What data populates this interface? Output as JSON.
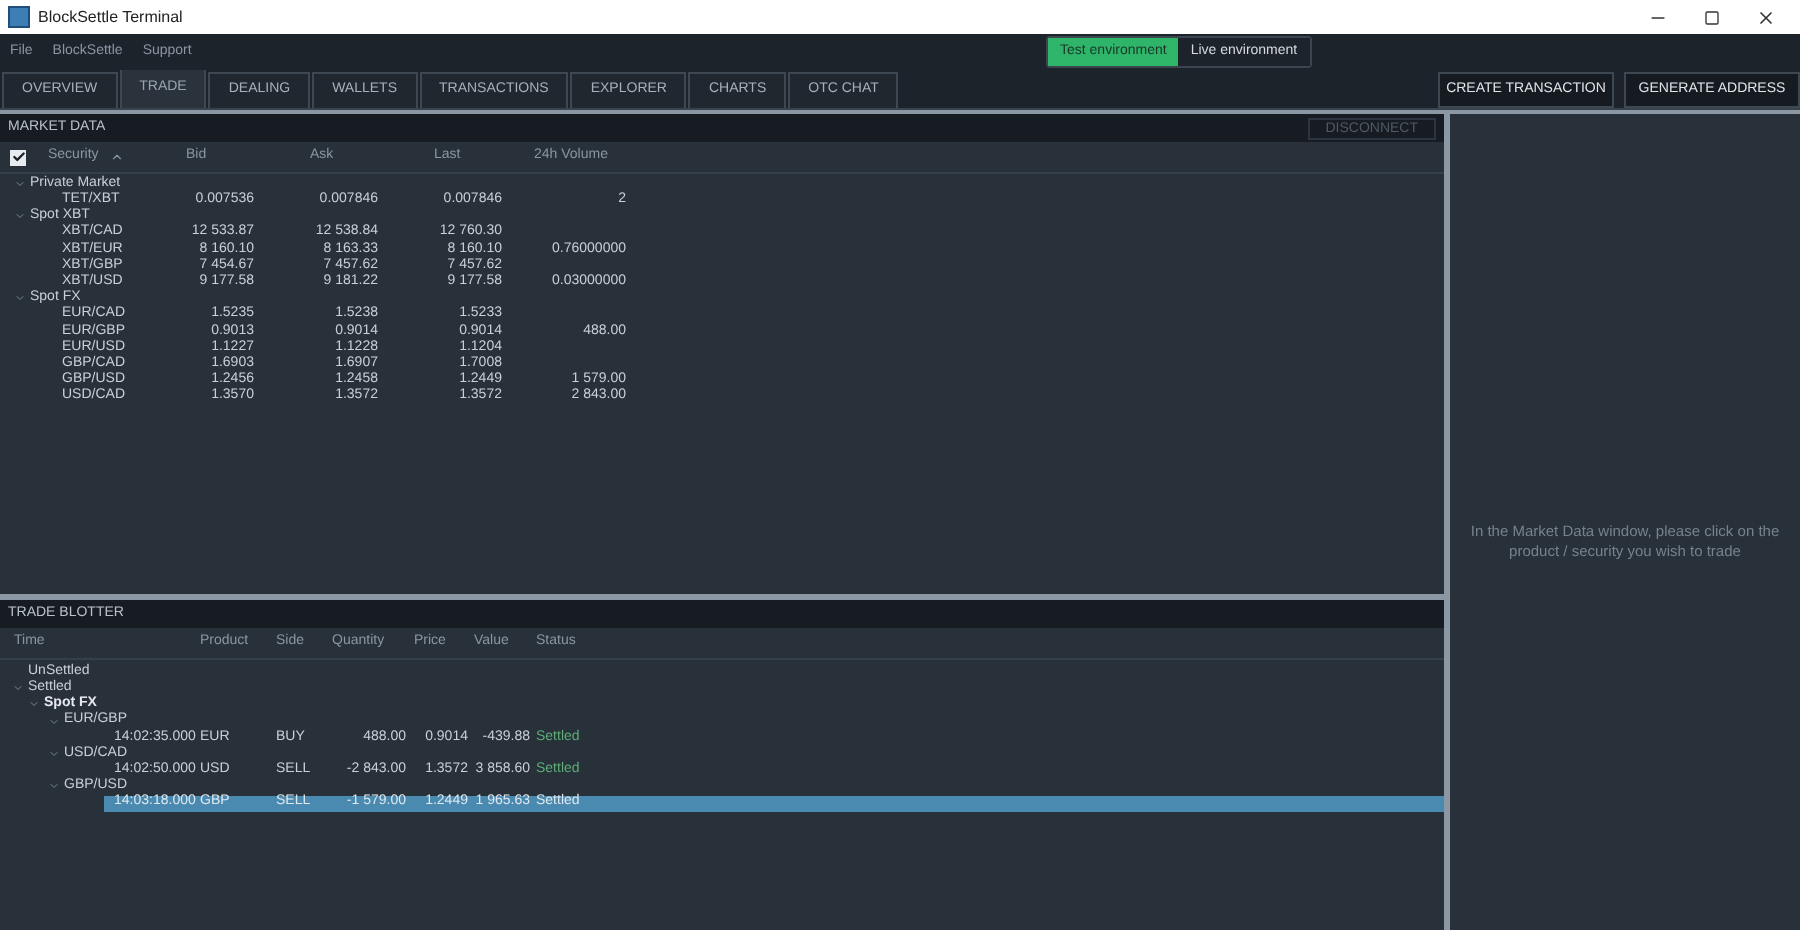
{
  "window": {
    "title": "BlockSettle Terminal"
  },
  "menu": [
    "File",
    "BlockSettle",
    "Support"
  ],
  "environment": [
    {
      "label": "Test environment",
      "selected": true
    },
    {
      "label": "Live environment",
      "selected": false
    }
  ],
  "tabs": [
    {
      "label": "OVERVIEW",
      "selected": false
    },
    {
      "label": "TRADE",
      "selected": true
    },
    {
      "label": "DEALING",
      "selected": false
    },
    {
      "label": "WALLETS",
      "selected": false
    },
    {
      "label": "TRANSACTIONS",
      "selected": false
    },
    {
      "label": "EXPLORER",
      "selected": false
    },
    {
      "label": "CHARTS",
      "selected": false
    },
    {
      "label": "OTC CHAT",
      "selected": false
    }
  ],
  "actions": [
    "CREATE TRANSACTION",
    "GENERATE ADDRESS"
  ],
  "market_data": {
    "title": "MARKET DATA",
    "disconnect": {
      "label": "DISCONNECT",
      "disabled": true
    },
    "checked": true,
    "columns": [
      "Security",
      "Bid",
      "Ask",
      "Last",
      "24h Volume"
    ],
    "groups": [
      {
        "name": "Private Market",
        "expanded": true,
        "rows": [
          {
            "security": "TET/XBT",
            "bid": "0.007536",
            "ask": "0.007846",
            "last": "0.007846",
            "volume": "2"
          }
        ]
      },
      {
        "name": "Spot XBT",
        "expanded": true,
        "rows": [
          {
            "security": "XBT/CAD",
            "bid": "12 533.87",
            "ask": "12 538.84",
            "last": "12 760.30"
          },
          {
            "security": "XBT/EUR",
            "bid": "8 160.10",
            "ask": "8 163.33",
            "last": "8 160.10",
            "volume": "0.76000000"
          },
          {
            "security": "XBT/GBP",
            "bid": "7 454.67",
            "ask": "7 457.62",
            "last": "7 457.62"
          },
          {
            "security": "XBT/USD",
            "bid": "9 177.58",
            "ask": "9 181.22",
            "last": "9 177.58",
            "volume": "0.03000000"
          }
        ]
      },
      {
        "name": "Spot FX",
        "expanded": true,
        "rows": [
          {
            "security": "EUR/CAD",
            "bid": "1.5235",
            "ask": "1.5238",
            "last": "1.5233"
          },
          {
            "security": "EUR/GBP",
            "bid": "0.9013",
            "ask": "0.9014",
            "last": "0.9014",
            "volume": "488.00"
          },
          {
            "security": "EUR/USD",
            "bid": "1.1227",
            "ask": "1.1228",
            "last": "1.1204"
          },
          {
            "security": "GBP/CAD",
            "bid": "1.6903",
            "ask": "1.6907",
            "last": "1.7008"
          },
          {
            "security": "GBP/USD",
            "bid": "1.2456",
            "ask": "1.2458",
            "last": "1.2449",
            "volume": "1 579.00"
          },
          {
            "security": "USD/CAD",
            "bid": "1.3570",
            "ask": "1.3572",
            "last": "1.3572",
            "volume": "2 843.00"
          }
        ]
      }
    ]
  },
  "trade_blotter": {
    "title": "TRADE BLOTTER",
    "columns": [
      "Time",
      "Product",
      "Side",
      "Quantity",
      "Price",
      "Value",
      "Status"
    ],
    "nodes": [
      {
        "label": "UnSettled"
      },
      {
        "label": "Settled",
        "expanded": true,
        "children": [
          {
            "label": "Spot FX",
            "expanded": true,
            "children": [
              {
                "label": "EUR/GBP",
                "expanded": true,
                "trades": [
                  {
                    "time": "14:02:35.000",
                    "product": "EUR",
                    "side": "BUY",
                    "quantity": "488.00",
                    "price": "0.9014",
                    "value": "-439.88",
                    "status": "Settled",
                    "selected": false
                  }
                ]
              },
              {
                "label": "USD/CAD",
                "expanded": true,
                "trades": [
                  {
                    "time": "14:02:50.000",
                    "product": "USD",
                    "side": "SELL",
                    "quantity": "-2 843.00",
                    "price": "1.3572",
                    "value": "3 858.60",
                    "status": "Settled",
                    "selected": false
                  }
                ]
              },
              {
                "label": "GBP/USD",
                "expanded": true,
                "trades": [
                  {
                    "time": "14:03:18.000",
                    "product": "GBP",
                    "side": "SELL",
                    "quantity": "-1 579.00",
                    "price": "1.2449",
                    "value": "1 965.63",
                    "status": "Settled",
                    "selected": true
                  }
                ]
              }
            ]
          }
        ]
      }
    ]
  },
  "hint": "In the Market Data window, please click on the product / security you wish to trade"
}
